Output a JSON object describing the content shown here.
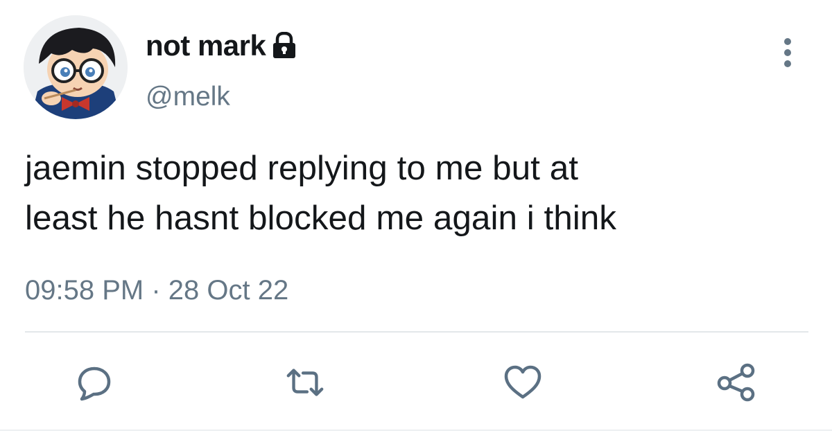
{
  "tweet": {
    "author": {
      "display_name": "not mark",
      "handle": "@melk",
      "avatar_icon": "anime-character-avatar",
      "protected_icon": "lock-icon"
    },
    "text": "jaemin stopped replying to me but at\nleast he hasnt blocked me again i think",
    "time": "09:58 PM",
    "separator": "·",
    "date": "28 Oct 22",
    "actions": [
      {
        "name": "reply",
        "icon": "reply-icon"
      },
      {
        "name": "retweet",
        "icon": "retweet-icon"
      },
      {
        "name": "like",
        "icon": "heart-icon"
      },
      {
        "name": "share",
        "icon": "share-icon"
      }
    ]
  },
  "colors": {
    "text": "#14171a",
    "secondary": "#657786",
    "divider": "#e3e7ea",
    "icon": "#5b7083"
  }
}
